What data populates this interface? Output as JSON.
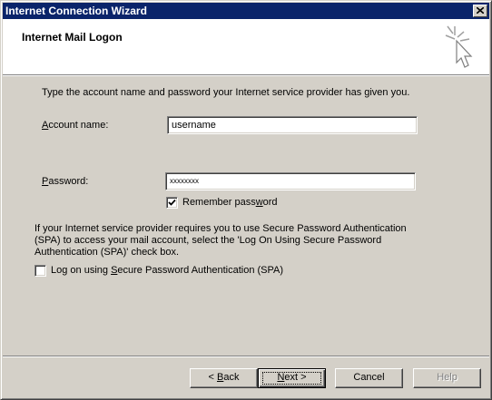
{
  "window": {
    "title": "Internet Connection Wizard",
    "title_bar_color": "#0a246a",
    "close_icon": "close-icon"
  },
  "header": {
    "title": "Internet Mail Logon",
    "icon": "wizard-sparkle-cursor-icon"
  },
  "form": {
    "intro": "Type the account name and password your Internet service provider has given you.",
    "account_label_access": "A",
    "account_label_rest": "ccount name:",
    "account_value": "username",
    "password_label_access": "P",
    "password_label_rest": "assword:",
    "password_value": "xxxxxxxx",
    "remember_label_pre": "Remember pass",
    "remember_label_access": "w",
    "remember_label_post": "ord",
    "remember_checked": true
  },
  "spa": {
    "description": "If your Internet service provider requires you to use Secure Password Authentication (SPA) to access your mail account, select the 'Log On Using Secure Password Authentication (SPA)' check box.",
    "checkbox_label_pre": "Log on using ",
    "checkbox_label_access": "S",
    "checkbox_label_post": "ecure Password Authentication (SPA)",
    "checked": false
  },
  "buttons": {
    "back_pre": "< ",
    "back_access": "B",
    "back_post": "ack",
    "next_access": "N",
    "next_post": "ext >",
    "cancel": "Cancel",
    "help": "Help"
  }
}
